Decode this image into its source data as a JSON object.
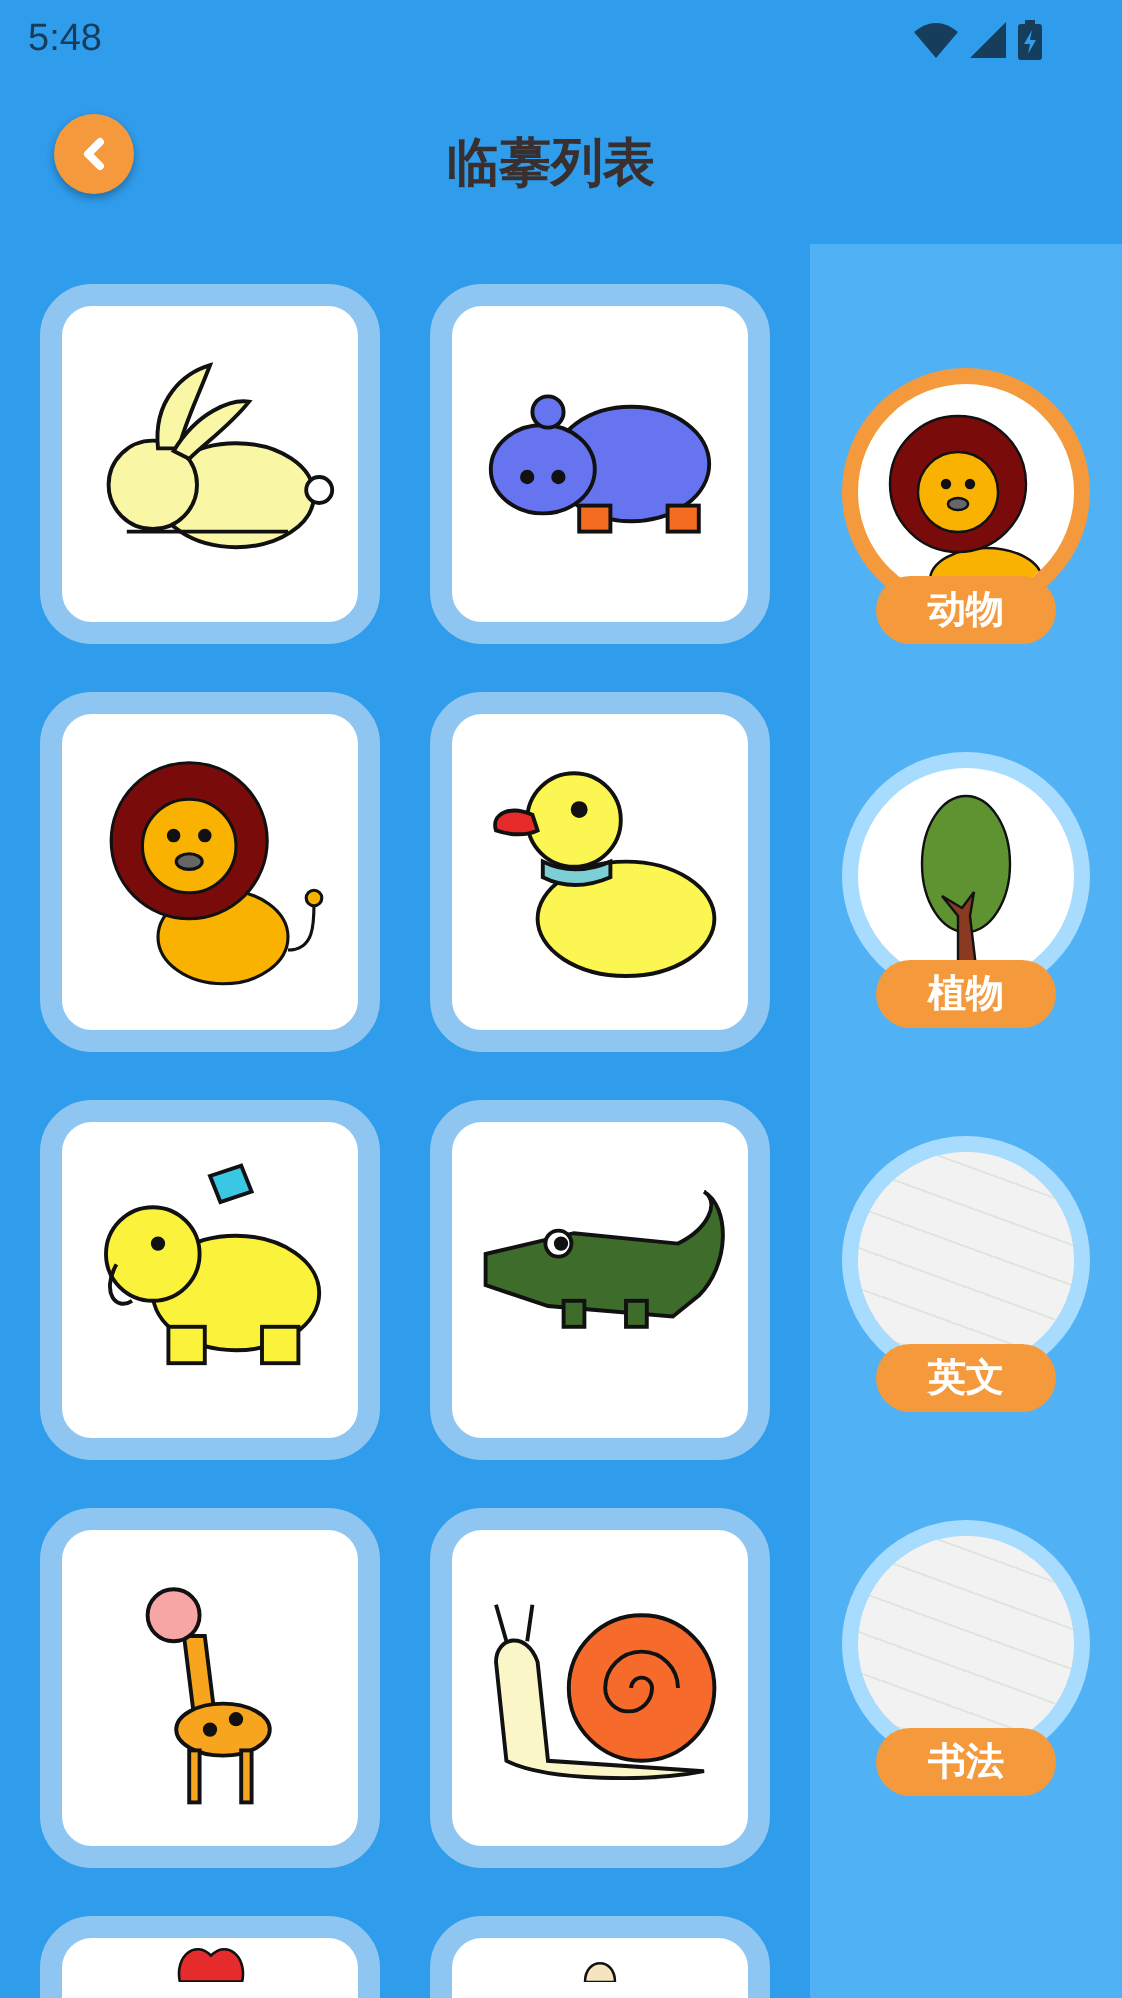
{
  "status_bar": {
    "time": "5:48"
  },
  "header": {
    "title": "临摹列表"
  },
  "cards": [
    {
      "kind": "rabbit"
    },
    {
      "kind": "hippo"
    },
    {
      "kind": "lion"
    },
    {
      "kind": "duck"
    },
    {
      "kind": "elephant"
    },
    {
      "kind": "crocodile"
    },
    {
      "kind": "giraffe"
    },
    {
      "kind": "snail"
    },
    {
      "kind": "partial-red"
    },
    {
      "kind": "partial-beige"
    }
  ],
  "sidebar": {
    "items": [
      {
        "label": "动物",
        "kind": "lion",
        "selected": true
      },
      {
        "label": "植物",
        "kind": "tree",
        "selected": false
      },
      {
        "label": "英文",
        "kind": "photo",
        "selected": false
      },
      {
        "label": "书法",
        "kind": "photo",
        "selected": false
      }
    ]
  }
}
